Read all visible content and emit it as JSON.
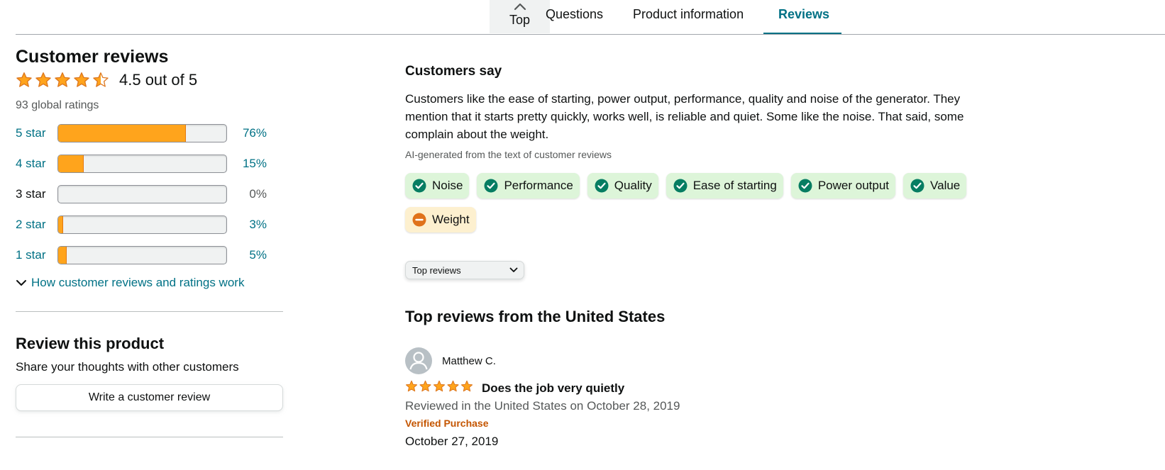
{
  "nav": {
    "top": "Top",
    "questions": "Questions",
    "product_info": "Product information",
    "reviews": "Reviews"
  },
  "reviews_summary": {
    "heading": "Customer reviews",
    "rating_value": 4.5,
    "rating_text": "4.5 out of 5",
    "global_ratings": "93 global ratings",
    "histogram": [
      {
        "label": "5 star",
        "percent_text": "76%",
        "percent": 76
      },
      {
        "label": "4 star",
        "percent_text": "15%",
        "percent": 15
      },
      {
        "label": "3 star",
        "percent_text": "0%",
        "percent": 0
      },
      {
        "label": "2 star",
        "percent_text": "3%",
        "percent": 3
      },
      {
        "label": "1 star",
        "percent_text": "5%",
        "percent": 5
      }
    ],
    "how_link": "How customer reviews and ratings work"
  },
  "review_product": {
    "heading": "Review this product",
    "subtext": "Share your thoughts with other customers",
    "button": "Write a customer review"
  },
  "customers_say": {
    "heading": "Customers say",
    "summary": "Customers like the ease of starting, power output, performance, quality and noise of the generator. They mention that it starts pretty quickly, works well, is reliable and quiet. Some like the noise. That said, some complain about the weight.",
    "ai_note": "AI-generated from the text of customer reviews",
    "chips": [
      {
        "label": "Noise",
        "sentiment": "positive"
      },
      {
        "label": "Performance",
        "sentiment": "positive"
      },
      {
        "label": "Quality",
        "sentiment": "positive"
      },
      {
        "label": "Ease of starting",
        "sentiment": "positive"
      },
      {
        "label": "Power output",
        "sentiment": "positive"
      },
      {
        "label": "Value",
        "sentiment": "positive"
      },
      {
        "label": "Weight",
        "sentiment": "negative"
      }
    ]
  },
  "sort": {
    "selected": "Top reviews"
  },
  "top_reviews": {
    "heading": "Top reviews from the United States",
    "items": [
      {
        "reviewer": "Matthew C.",
        "stars": 5,
        "title": "Does the job very quietly",
        "meta": "Reviewed in the United States on October 28, 2019",
        "verified": "Verified Purchase",
        "date_line": "October 27, 2019"
      }
    ]
  },
  "colors": {
    "link": "#007185",
    "star": "#ffa41c",
    "positive_chip": "#ddf5d9",
    "positive_icon": "#067d62",
    "negative_chip": "#fdf0cf",
    "negative_icon": "#e0721a",
    "verified": "#c45500"
  },
  "icons": {
    "top_tab": "chevron-up-icon",
    "how_link": "chevron-down-icon",
    "positive_chip": "check-circle-icon",
    "negative_chip": "minus-circle-icon",
    "sort": "chevron-down-icon",
    "avatar": "user-avatar-icon",
    "rating": "star-icon"
  }
}
